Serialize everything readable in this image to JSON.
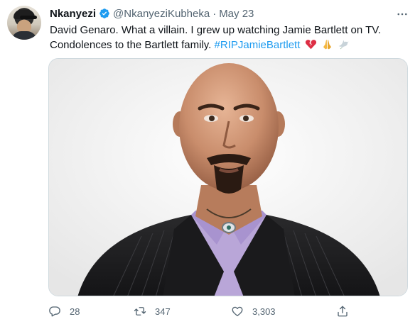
{
  "tweet": {
    "author_name": "Nkanyezi",
    "handle": "@NkanyeziKubheka",
    "separator": "·",
    "date": "May 23",
    "text_line1": "David Genaro. What a villain. I grew up watching Jamie Bartlett on TV.",
    "text_line2": "Condolences to the Bartlett family.",
    "hashtag": "#RIPJamieBartlett",
    "emojis": [
      "broken-heart",
      "folded-hands",
      "dove"
    ],
    "verified": true
  },
  "actions": {
    "reply_count": "28",
    "retweet_count": "347",
    "like_count": "3,303"
  },
  "icons": {
    "reply": "reply-icon",
    "retweet": "retweet-icon",
    "like": "heart-icon",
    "share": "share-icon",
    "more": "more-icon",
    "verified": "verified-badge-icon"
  },
  "colors": {
    "accent": "#1d9bf0",
    "secondary_text": "#536471",
    "border": "#cfd9de"
  }
}
